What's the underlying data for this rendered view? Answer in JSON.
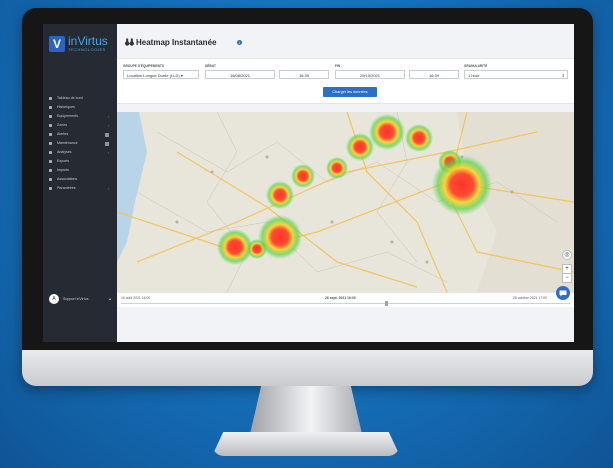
{
  "app": {
    "logo_initial": "V",
    "logo_name": "inVirtus",
    "logo_sub": "TECHNOLOGIES"
  },
  "sidebar": {
    "items": [
      {
        "label": "Tableau de bord",
        "icon": "home-icon",
        "chevron": false,
        "badge": false
      },
      {
        "label": "Historiques",
        "icon": "chart-icon",
        "chevron": false,
        "badge": false
      },
      {
        "label": "Equipements",
        "icon": "box-icon",
        "chevron": true,
        "badge": false
      },
      {
        "label": "Zones",
        "icon": "circle-icon",
        "chevron": true,
        "badge": false
      },
      {
        "label": "Alertes",
        "icon": "bell-icon",
        "chevron": false,
        "badge": true
      },
      {
        "label": "Maintenance",
        "icon": "wrench-icon",
        "chevron": false,
        "badge": true
      },
      {
        "label": "Analyses",
        "icon": "analytics-icon",
        "chevron": true,
        "badge": false
      },
      {
        "label": "Exports",
        "icon": "export-icon",
        "chevron": false,
        "badge": false
      },
      {
        "label": "Imports",
        "icon": "import-icon",
        "chevron": false,
        "badge": false
      },
      {
        "label": "Associations",
        "icon": "link-icon",
        "chevron": false,
        "badge": false
      },
      {
        "label": "Paramètres",
        "icon": "settings-icon",
        "chevron": true,
        "badge": false
      }
    ],
    "user": {
      "initial": "A",
      "name": "Support inVirtus",
      "chevron": "▴"
    }
  },
  "header": {
    "title": "Heatmap Instantanée",
    "title_icon": "binoculars-icon",
    "info_icon": "i"
  },
  "filters": {
    "group_label": "GROUPE D'ÉQUIPEMENTS",
    "group_value": "Location Longue Durée (LLD) ▾",
    "start_label": "DÉBUT",
    "start_date": "16/08/2021",
    "start_time": "16:39",
    "end_label": "FIN",
    "end_date": "25/10/2021",
    "end_time": "16:39",
    "granularity_label": "GRANULARITÉ",
    "granularity_value": "1 hour",
    "load_button": "Charger les données"
  },
  "timeline": {
    "start": "16 août 2021 16:00",
    "current": "26 sept. 2021 16:00",
    "end": "25 octobre 2021 17:00"
  },
  "map": {
    "zoom_in": "+",
    "zoom_out": "−",
    "locate": "◎",
    "heat_colors": [
      "#ff2a1f",
      "#ffd21e",
      "#55d34a"
    ]
  },
  "chat": {
    "icon": "chat-icon"
  }
}
